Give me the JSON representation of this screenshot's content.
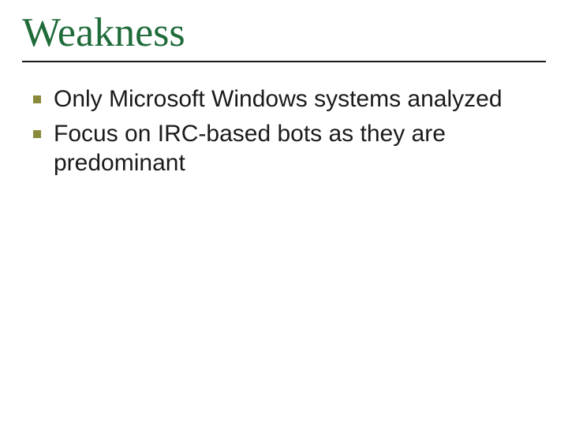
{
  "slide": {
    "title": "Weakness",
    "bullets": [
      {
        "text": "Only Microsoft Windows systems analyzed"
      },
      {
        "text": "Focus on IRC-based bots as they are predominant"
      }
    ]
  }
}
